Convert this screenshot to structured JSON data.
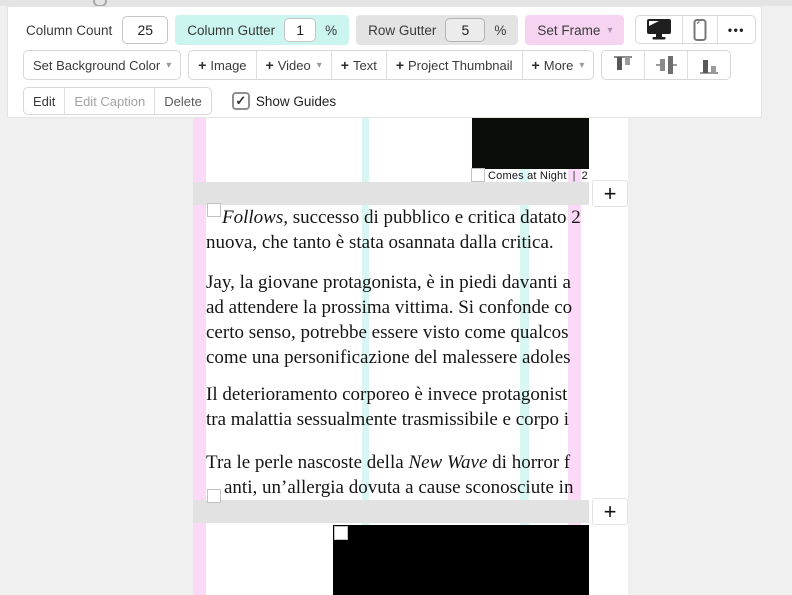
{
  "toolbar": {
    "column_count_label": "Column Count",
    "column_count_value": "25",
    "column_gutter_label": "Column Gutter",
    "column_gutter_value": "1",
    "column_gutter_unit": "%",
    "row_gutter_label": "Row Gutter",
    "row_gutter_value": "5",
    "row_gutter_unit": "%",
    "set_frame_label": "Set Frame",
    "set_background_label": "Set Background Color",
    "add_image_label": "Image",
    "add_video_label": "Video",
    "add_text_label": "Text",
    "add_project_thumbnail_label": "Project Thumbnail",
    "add_more_label": "More",
    "edit_label": "Edit",
    "edit_caption_label": "Edit Caption",
    "delete_label": "Delete",
    "show_guides_label": "Show Guides"
  },
  "icons": {
    "plus": "+",
    "caret": "▾",
    "ellipsis": "•••",
    "check": "✓",
    "add_row_plus": "+"
  },
  "canvas": {
    "caption_top_text": "Comes at Night",
    "caption_top_sep": "|",
    "caption_top_year": "2",
    "p1_line1_italic": "Follows,",
    "p1_line1_rest": " successo di pubblico e critica datato 2",
    "p1_line2": "nuova, che tanto è stata osannata dalla critica.",
    "p2_line1": "Jay, la giovane protagonista, è in piedi davanti a",
    "p2_line2": "ad attendere la prossima vittima. Si confonde co",
    "p2_line3": "certo senso, potrebbe essere visto come qualcos",
    "p2_line4": "come una personificazione del malessere adoles",
    "p3_line1": "Il deterioramento corporeo è invece protagonist",
    "p3_line2": "tra malattia sessualmente trasmissibile e corpo i",
    "p4_line1_pre": "Tra le perle nascoste della ",
    "p4_line1_italic": "New Wave",
    "p4_line1_post": " di horror f",
    "p4_line2": "anti, un’allergia dovuta a cause sconosciute in"
  },
  "colors": {
    "accent_cyan": "#cbf5ee",
    "accent_pink": "#f6d4f1",
    "guide_pink": "#fbdaf7",
    "guide_cyan": "#d8f6f4",
    "row_gutter_band": "#e2e2e2",
    "page_background": "#f0f0f0"
  }
}
